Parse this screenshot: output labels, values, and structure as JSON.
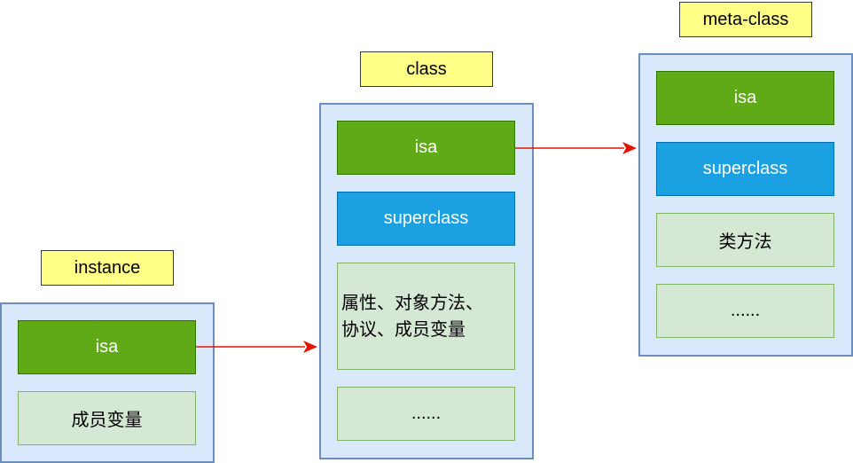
{
  "instance": {
    "title": "instance",
    "isa": "isa",
    "ivars": "成员变量"
  },
  "class": {
    "title": "class",
    "isa": "isa",
    "superclass": "superclass",
    "members_line1": "属性、对象方法、",
    "members_line2": "协议、成员变量",
    "more": "......"
  },
  "meta_class": {
    "title": "meta-class",
    "isa": "isa",
    "superclass": "superclass",
    "class_methods": "类方法",
    "more": "......"
  },
  "colors": {
    "label_fill": "#ffff88",
    "container_fill": "#dae8fc",
    "container_border": "#6c8ebf",
    "isa_fill": "#60a917",
    "superclass_fill": "#1ba1e2",
    "plain_fill": "#d5e8d4",
    "arrow": "#e51400"
  }
}
